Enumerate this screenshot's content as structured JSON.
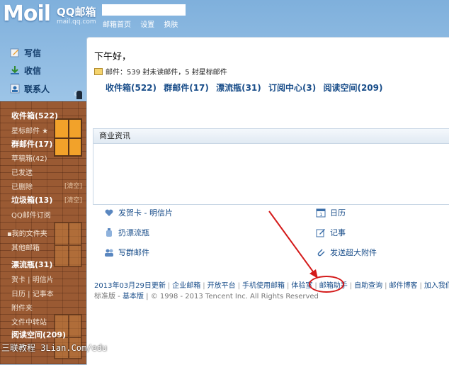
{
  "brand": {
    "logo": "Moil",
    "name": "QQ邮箱",
    "domain": "mail.qq.com"
  },
  "top_links": [
    "邮箱首页",
    "设置",
    "换肤"
  ],
  "nav": {
    "write": "写信",
    "inbox": "收信",
    "contacts": "联系人"
  },
  "folders_side": [
    {
      "label": "收件箱(522)",
      "bold": true
    },
    {
      "label": "星标邮件 ★",
      "bold": false
    },
    {
      "label": "群邮件(17)",
      "bold": true
    },
    {
      "label": "草稿箱(42)",
      "bold": false
    },
    {
      "label": "已发送",
      "bold": false
    },
    {
      "label": "已删除",
      "bold": false,
      "tag": "[清空]"
    },
    {
      "label": "垃圾箱(13)",
      "bold": true,
      "tag": "[清空]"
    },
    {
      "label": "QQ邮件订阅",
      "bold": false
    },
    {
      "label": "我的文件夹",
      "bold": false
    },
    {
      "label": "其他邮箱",
      "bold": false
    },
    {
      "label": "漂流瓶(31)",
      "bold": true
    },
    {
      "label": "贺卡 | 明信片",
      "bold": false
    },
    {
      "label": "日历 | 记事本",
      "bold": false
    },
    {
      "label": "附件夹",
      "bold": false
    },
    {
      "label": "文件中转站",
      "bold": false
    },
    {
      "label": "阅读空间(209)",
      "bold": true
    }
  ],
  "main": {
    "greeting": "下午好，",
    "mail_summary": "邮件：539 封未读邮件，5 封星标邮件",
    "folder_links": [
      "收件箱(522)",
      "群邮件(17)",
      "漂流瓶(31)",
      "订阅中心(3)",
      "阅读空间(209)"
    ],
    "biz_title": "商业资讯",
    "quick_left": [
      "发贺卡 - 明信片",
      "扔漂流瓶",
      "写群邮件"
    ],
    "quick_right": [
      "日历",
      "记事",
      "发送超大附件"
    ]
  },
  "footer": {
    "links": [
      "2013年03月29日更新",
      "企业邮箱",
      "开放平台",
      "手机使用邮箱",
      "体验室",
      "邮箱助手",
      "自助查询",
      "邮件博客",
      "加入我们"
    ],
    "version_prefix": "标准版",
    "version_link": "基本版",
    "copyright": "© 1998 - 2013 Tencent Inc. All Rights Reserved"
  },
  "watermark": "三联教程 3Lian.Com/edu",
  "colors": {
    "link": "#1a4e8a",
    "highlight": "#d41a1a",
    "wall": "#9a5a33"
  }
}
